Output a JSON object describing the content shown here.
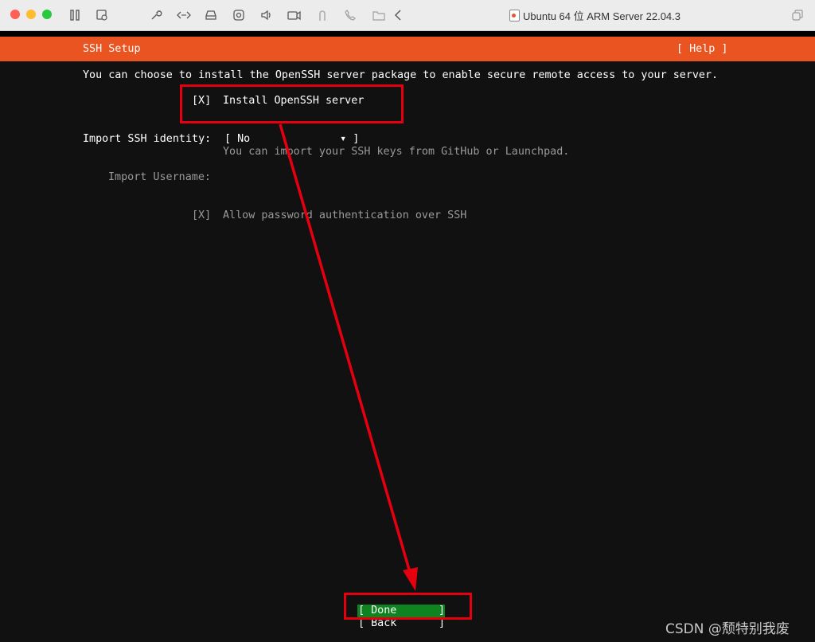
{
  "window": {
    "title": "Ubuntu 64 位 ARM Server 22.04.3",
    "icons": [
      "pause-icon",
      "snapshot-icon",
      "settings-wrench-icon",
      "network-icon",
      "disk-icon",
      "camera-icon",
      "sound-icon",
      "video-icon",
      "usb-icon",
      "phone-icon",
      "share-folder-icon",
      "back-chevron-icon",
      "restore-window-icon"
    ]
  },
  "installer": {
    "header_title": "SSH Setup",
    "help": "[ Help ]",
    "intro": "You can choose to install the OpenSSH server package to enable secure remote access to your server.",
    "install_checkbox": "[X]",
    "install_label": "Install OpenSSH server",
    "import_identity_label": "Import SSH identity:",
    "import_identity_value": "[ No              ▾ ]",
    "import_identity_hint": "You can import your SSH keys from GitHub or Launchpad.",
    "import_username_label": "Import Username:",
    "password_checkbox": "[X]",
    "password_label": "Allow password authentication over SSH",
    "done_left": "[ Done",
    "done_right": "]",
    "back_left": "[ Back",
    "back_right": "]"
  },
  "watermark": "CSDN @颓特别我废",
  "colors": {
    "header": "#e95420",
    "done_button": "#0e8420",
    "annotation": "#e6000f"
  }
}
